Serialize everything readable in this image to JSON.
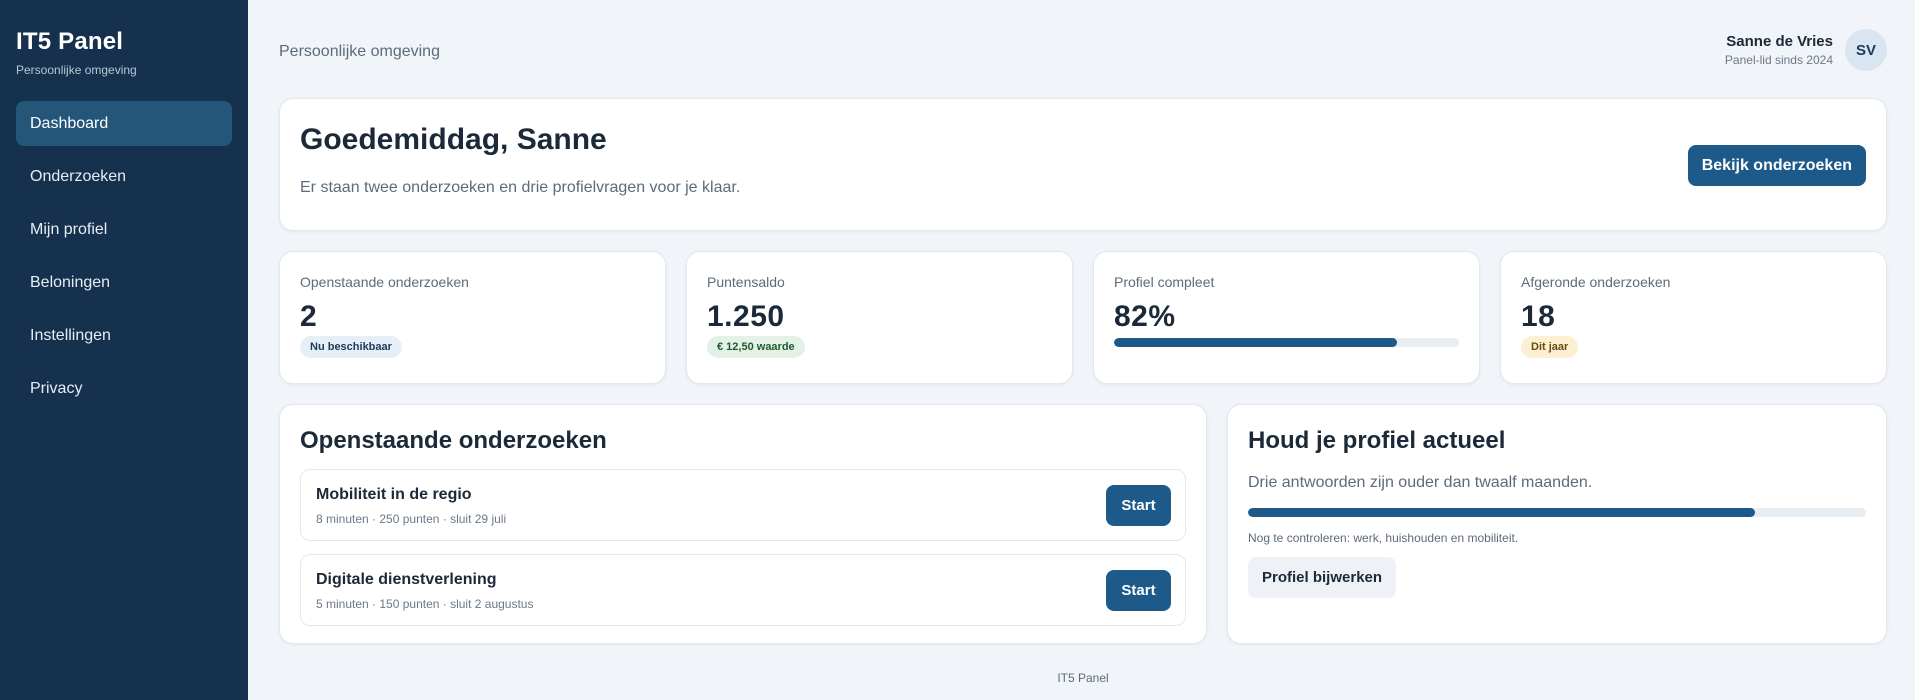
{
  "sidebar": {
    "title": "IT5 Panel",
    "subtitle": "Persoonlijke omgeving",
    "items": [
      {
        "label": "Dashboard",
        "active": true
      },
      {
        "label": "Onderzoeken",
        "active": false
      },
      {
        "label": "Mijn profiel",
        "active": false
      },
      {
        "label": "Beloningen",
        "active": false
      },
      {
        "label": "Instellingen",
        "active": false
      },
      {
        "label": "Privacy",
        "active": false
      }
    ]
  },
  "header": {
    "breadcrumb": "Persoonlijke omgeving",
    "user_name": "Sanne de Vries",
    "user_since": "Panel-lid sinds 2024",
    "avatar_initials": "SV"
  },
  "hero": {
    "title": "Goedemiddag, Sanne",
    "text": "Er staan twee onderzoeken en drie profielvragen voor je klaar.",
    "button_label": "Bekijk onderzoeken"
  },
  "stats": {
    "open": {
      "label": "Openstaande onderzoeken",
      "value": "2",
      "badge": "Nu beschikbaar"
    },
    "points": {
      "label": "Puntensaldo",
      "value": "1.250",
      "badge": "€ 12,50 waarde"
    },
    "profile": {
      "label": "Profiel compleet",
      "value": "82%",
      "progress": 0.82
    },
    "completed": {
      "label": "Afgeronde onderzoeken",
      "value": "18",
      "badge": "Dit jaar"
    }
  },
  "surveys": {
    "title": "Openstaande onderzoeken",
    "items": [
      {
        "name": "Mobiliteit in de regio",
        "meta": "8 minuten · 250 punten · sluit 29 juli",
        "button": "Start"
      },
      {
        "name": "Digitale dienstverlening",
        "meta": "5 minuten · 150 punten · sluit 2 augustus",
        "button": "Start"
      }
    ]
  },
  "profile_panel": {
    "title": "Houd je profiel actueel",
    "text": "Drie antwoorden zijn ouder dan twaalf maanden.",
    "progress": 0.82,
    "note": "Nog te controleren: werk, huishouden en mobiliteit.",
    "button_label": "Profiel bijwerken"
  },
  "footer": {
    "text": "IT5 Panel"
  },
  "colors": {
    "sidebar": "#16314e",
    "accent": "#1d5a8a",
    "background": "#f1f4f8"
  }
}
